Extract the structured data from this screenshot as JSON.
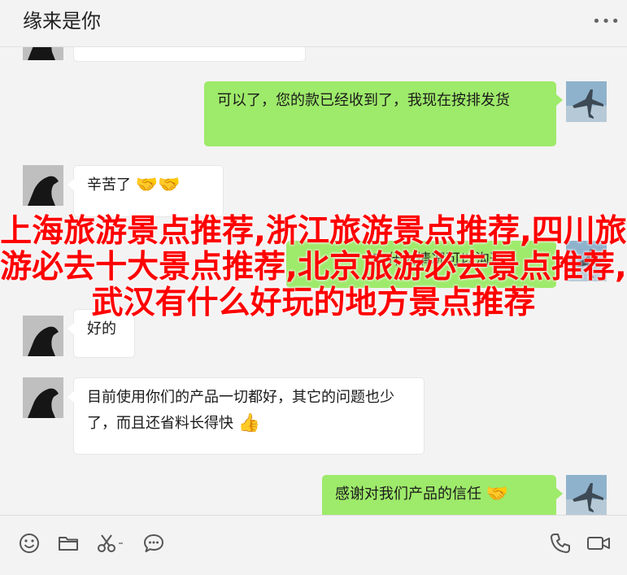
{
  "header": {
    "title": "缘来是你",
    "more_icon": "more-dots-icon",
    "more_glyph": "•••"
  },
  "messages": [
    {
      "side": "left",
      "avatar": "horse-avatar",
      "text": ""
    },
    {
      "side": "right",
      "avatar": "jet-avatar",
      "text": "可以了，您的款已经收到了，我现在按排发货"
    },
    {
      "side": "left",
      "avatar": "horse-avatar",
      "text": "辛苦了",
      "emoji": "🤝🤝"
    },
    {
      "side": "right",
      "avatar": "jet-avatar",
      "text": "有什么情况可以沟通"
    },
    {
      "side": "left",
      "avatar": "horse-avatar",
      "text": "好的"
    },
    {
      "side": "left",
      "avatar": "horse-avatar",
      "text": "目前使用你们的产品一切都好，其它的问题也少了，而且还省料长得快",
      "emoji": "👍"
    },
    {
      "side": "right",
      "avatar": "jet-avatar",
      "text": "感谢对我们产品的信任",
      "emoji": "🤝"
    }
  ],
  "overlay": {
    "text": "上海旅游景点推荐,浙江旅游景点推荐,四川旅游必去十大景点推荐,北京旅游必去景点推荐,武汉有什么好玩的地方景点推荐",
    "color": "#ff0000"
  },
  "toolbar": {
    "icons": [
      "emoji-icon",
      "folder-icon",
      "scissors-icon",
      "chat-bubble-icon",
      "phone-icon",
      "video-icon"
    ]
  },
  "colors": {
    "right_bubble": "#9eea6a",
    "left_bubble": "#ffffff",
    "background": "#f3f3f3"
  }
}
